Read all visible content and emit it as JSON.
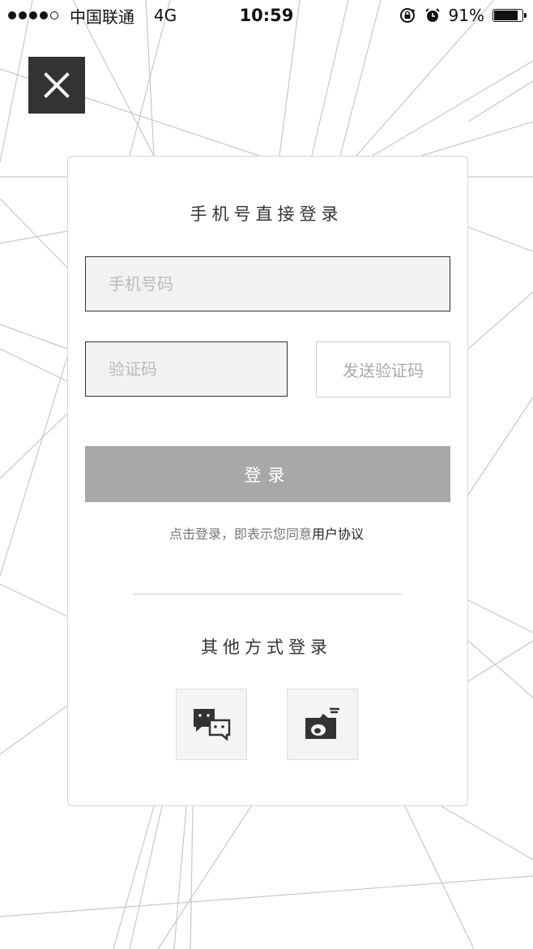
{
  "status_bar": {
    "carrier": "中国联通",
    "network": "4G",
    "time": "10:59",
    "battery_percent": "91%",
    "battery_level": 0.91,
    "signal_strength": 4,
    "signal_max": 5,
    "icons": [
      "rotation-lock-icon",
      "alarm-icon",
      "battery-icon"
    ]
  },
  "close_button": {
    "icon": "close-icon"
  },
  "login_card": {
    "title": "手机号直接登录",
    "phone_placeholder": "手机号码",
    "code_placeholder": "验证码",
    "send_code_label": "发送验证码",
    "login_label": "登录",
    "agreement_prefix": "点击登录，即表示您同意",
    "agreement_link": "用户协议"
  },
  "other_login": {
    "title": "其他方式登录",
    "options": [
      {
        "name": "wechat",
        "icon": "wechat-icon"
      },
      {
        "name": "weibo",
        "icon": "weibo-icon"
      }
    ]
  },
  "colors": {
    "close_bg": "#333333",
    "login_button_bg": "#a8a8a8",
    "input_bg": "#f2f2f2",
    "placeholder": "#bbbbbb"
  }
}
